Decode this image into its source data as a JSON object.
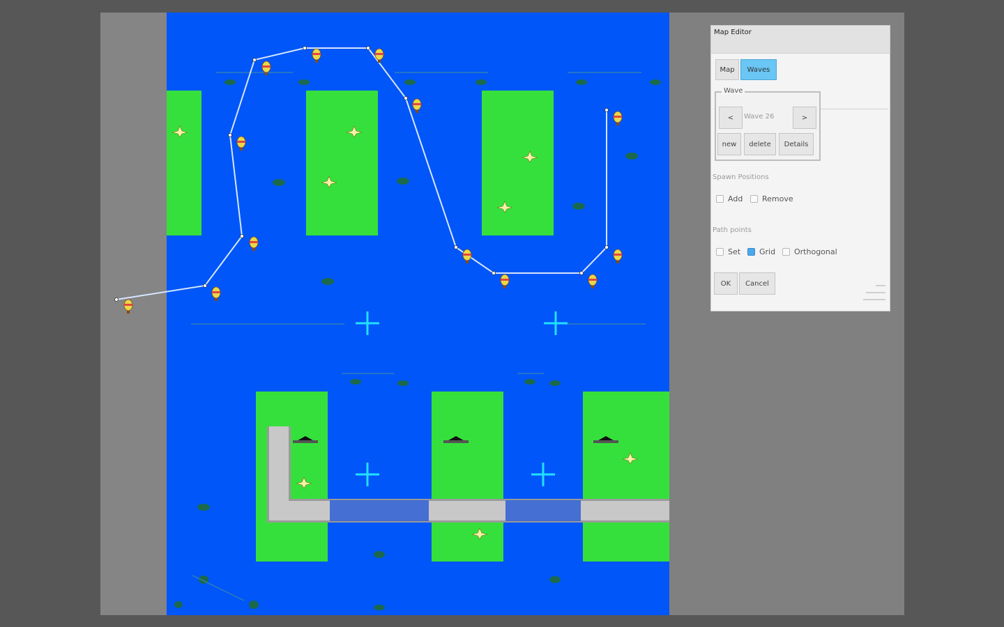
{
  "window": {
    "title": "Map Editor"
  },
  "tabs": [
    {
      "label": "Map",
      "active": false
    },
    {
      "label": "Waves",
      "active": true
    }
  ],
  "wave_group": {
    "legend": "Wave",
    "prev_label": "<",
    "next_label": ">",
    "current_wave": "Wave 26",
    "new_label": "new",
    "delete_label": "delete",
    "details_label": "Details"
  },
  "spawn_positions": {
    "label": "Spawn Positions",
    "add": {
      "label": "Add",
      "checked": false
    },
    "remove": {
      "label": "Remove",
      "checked": false
    }
  },
  "path_points": {
    "label": "Path points",
    "set": {
      "label": "Set",
      "checked": false
    },
    "grid": {
      "label": "Grid",
      "checked": true
    },
    "orthogonal": {
      "label": "Orthogonal",
      "checked": false
    }
  },
  "actions": {
    "ok_label": "OK",
    "cancel_label": "Cancel"
  },
  "colors": {
    "water": "#0056f8",
    "island": "#36e03c",
    "path_line": "#d6e6ff",
    "marker_cross": "#22e0ff",
    "active_tab": "#69c6f5",
    "workspace": "#808080",
    "background": "#575757"
  }
}
